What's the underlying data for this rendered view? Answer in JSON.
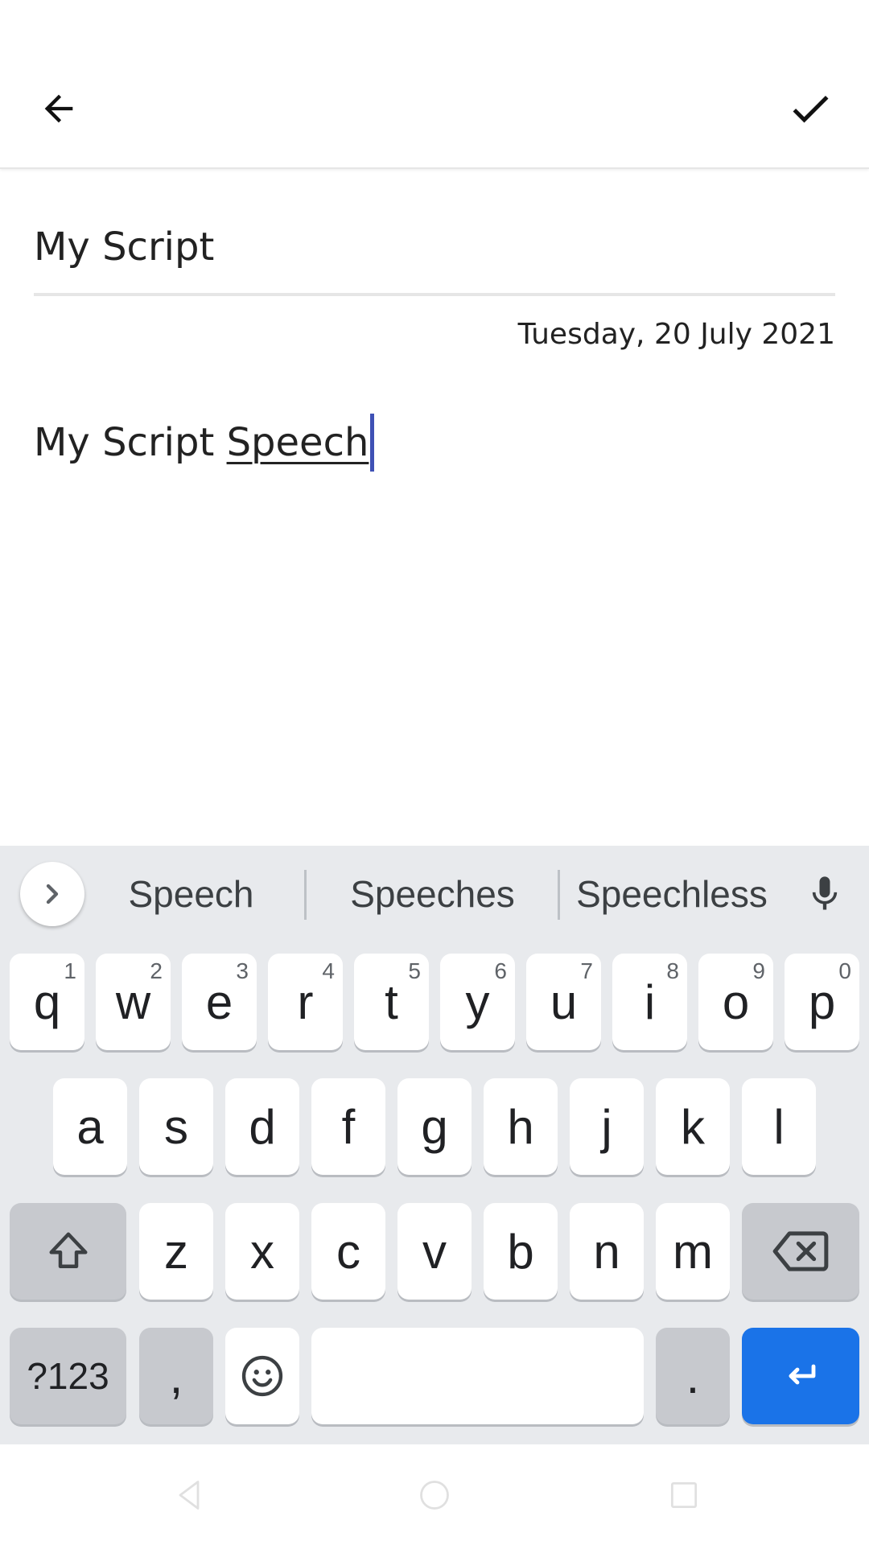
{
  "appbar": {
    "back_icon": "arrow-left-icon",
    "done_icon": "check-icon"
  },
  "editor": {
    "title_value": "My Script",
    "date": "Tuesday, 20 July 2021",
    "body_prefix": "My Script ",
    "body_composing": "Speech"
  },
  "keyboard": {
    "suggestions": [
      "Speech",
      "Speeches",
      "Speechless"
    ],
    "row1": [
      {
        "label": "q",
        "hint": "1"
      },
      {
        "label": "w",
        "hint": "2"
      },
      {
        "label": "e",
        "hint": "3"
      },
      {
        "label": "r",
        "hint": "4"
      },
      {
        "label": "t",
        "hint": "5"
      },
      {
        "label": "y",
        "hint": "6"
      },
      {
        "label": "u",
        "hint": "7"
      },
      {
        "label": "i",
        "hint": "8"
      },
      {
        "label": "o",
        "hint": "9"
      },
      {
        "label": "p",
        "hint": "0"
      }
    ],
    "row2": [
      "a",
      "s",
      "d",
      "f",
      "g",
      "h",
      "j",
      "k",
      "l"
    ],
    "row3": [
      "z",
      "x",
      "c",
      "v",
      "b",
      "n",
      "m"
    ],
    "symbols_label": "?123",
    "comma_label": ",",
    "period_label": ".",
    "accent_color": "#1a73e8"
  }
}
